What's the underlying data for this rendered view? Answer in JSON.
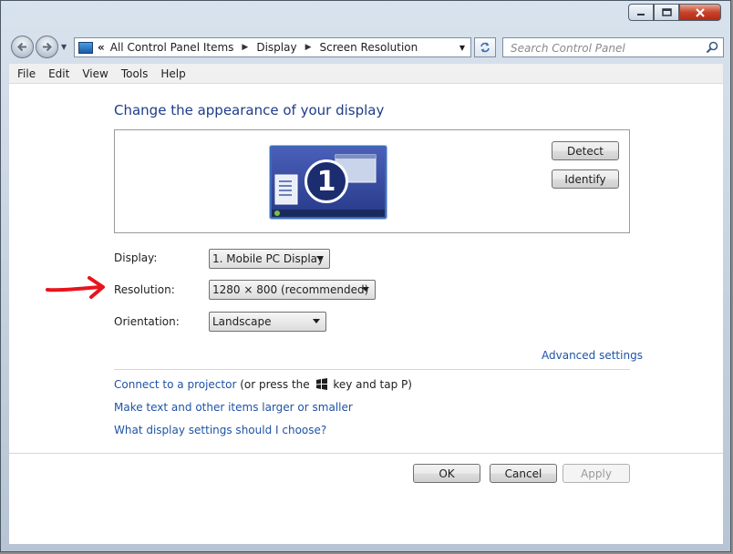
{
  "window": {
    "caption_buttons": [
      "minimize-icon",
      "maximize-icon",
      "close-icon"
    ]
  },
  "address_bar": {
    "overflow_glyph": "«",
    "crumbs": [
      "All Control Panel Items",
      "Display",
      "Screen Resolution"
    ],
    "icon": "control-panel-icon"
  },
  "search": {
    "placeholder": "Search Control Panel",
    "icon": "search-icon"
  },
  "menu": {
    "file": "File",
    "edit": "Edit",
    "view": "View",
    "tools": "Tools",
    "help": "Help"
  },
  "main": {
    "heading": "Change the appearance of your display",
    "monitor_number": "1",
    "detect_label": "Detect",
    "identify_label": "Identify",
    "display": {
      "label": "Display:",
      "value": "1. Mobile PC Display"
    },
    "resolution": {
      "label": "Resolution:",
      "value": "1280 × 800 (recommended)"
    },
    "orientation": {
      "label": "Orientation:",
      "value": "Landscape"
    },
    "advanced_link": "Advanced settings",
    "projector_link": "Connect to a projector",
    "projector_text_before": "(or press the",
    "projector_text_after": "key and tap P)",
    "text_size_link": "Make text and other items larger or smaller",
    "help_link": "What display settings should I choose?"
  },
  "footer": {
    "ok": "OK",
    "cancel": "Cancel",
    "apply": "Apply"
  },
  "colors": {
    "link": "#1e53a6",
    "heading": "#1e3c87",
    "annotation_arrow": "#e8141b"
  }
}
